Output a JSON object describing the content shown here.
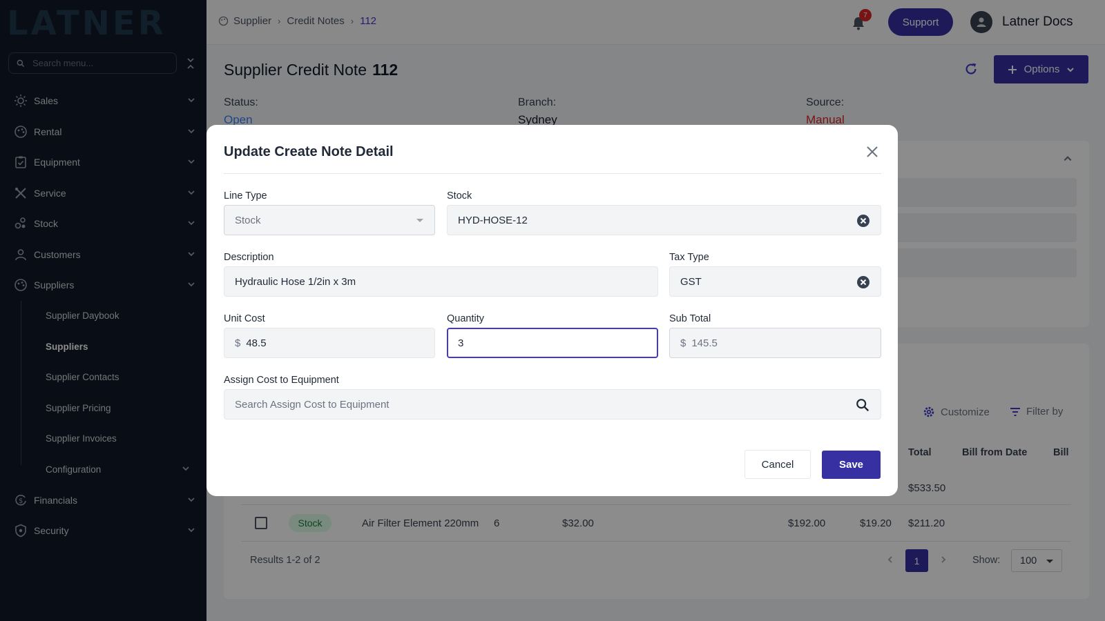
{
  "sidebar": {
    "logo": "LATNER",
    "search_placeholder": "Search menu...",
    "items": [
      {
        "label": "Sales",
        "icon": "sun-icon"
      },
      {
        "label": "Rental",
        "icon": "palette-icon"
      },
      {
        "label": "Equipment",
        "icon": "clipboard-icon"
      },
      {
        "label": "Service",
        "icon": "tools-icon"
      },
      {
        "label": "Stock",
        "icon": "boxes-icon"
      },
      {
        "label": "Customers",
        "icon": "person-icon"
      },
      {
        "label": "Suppliers",
        "icon": "palette-icon"
      }
    ],
    "sub_items": [
      {
        "label": "Supplier Daybook"
      },
      {
        "label": "Suppliers"
      },
      {
        "label": "Supplier Contacts"
      },
      {
        "label": "Supplier Pricing"
      },
      {
        "label": "Supplier Invoices"
      },
      {
        "label": "Configuration"
      }
    ],
    "items_after": [
      {
        "label": "Financials",
        "icon": "dollar-cycle-icon"
      },
      {
        "label": "Security",
        "icon": "shield-icon"
      }
    ]
  },
  "topbar": {
    "breadcrumb": [
      "Supplier",
      "Credit Notes",
      "112"
    ],
    "notifications_count": "7",
    "support_label": "Support",
    "user_name": "Latner Docs"
  },
  "page": {
    "title": "Supplier Credit Note",
    "number": "112",
    "options_label": "Options",
    "status_label": "Status:",
    "status_value": "Open",
    "branch_label": "Branch:",
    "branch_value": "Sydney",
    "source_label": "Source:",
    "source_value": "Manual",
    "colors": {
      "status": "#3b82f6",
      "source": "#dc2626",
      "accent": "#3730a3"
    }
  },
  "table": {
    "customize_label": "Customize",
    "filter_label": "Filter by",
    "headers": [
      "Total",
      "Bill from Date",
      "Bill t"
    ],
    "rows": [
      {
        "total": "$533.50"
      },
      {
        "type": "Stock",
        "description": "Air Filter Element 220mm",
        "qty": "6",
        "unit_cost": "$32.00",
        "sub_total": "$192.00",
        "tax": "$19.20",
        "total": "$211.20"
      }
    ],
    "results_text": "Results 1-2 of 2",
    "current_page": "1",
    "show_label": "Show:",
    "page_size": "100"
  },
  "modal": {
    "title": "Update Create Note Detail",
    "line_type_label": "Line Type",
    "line_type_value": "Stock",
    "stock_label": "Stock",
    "stock_value": "HYD-HOSE-12",
    "description_label": "Description",
    "description_value": "Hydraulic Hose 1/2in x 3m",
    "tax_type_label": "Tax Type",
    "tax_type_value": "GST",
    "unit_cost_label": "Unit Cost",
    "unit_cost_value": "48.5",
    "quantity_label": "Quantity",
    "quantity_value": "3",
    "sub_total_label": "Sub Total",
    "sub_total_value": "145.5",
    "currency_symbol": "$",
    "assign_label": "Assign Cost to Equipment",
    "assign_placeholder": "Search Assign Cost to Equipment",
    "cancel_label": "Cancel",
    "save_label": "Save"
  }
}
